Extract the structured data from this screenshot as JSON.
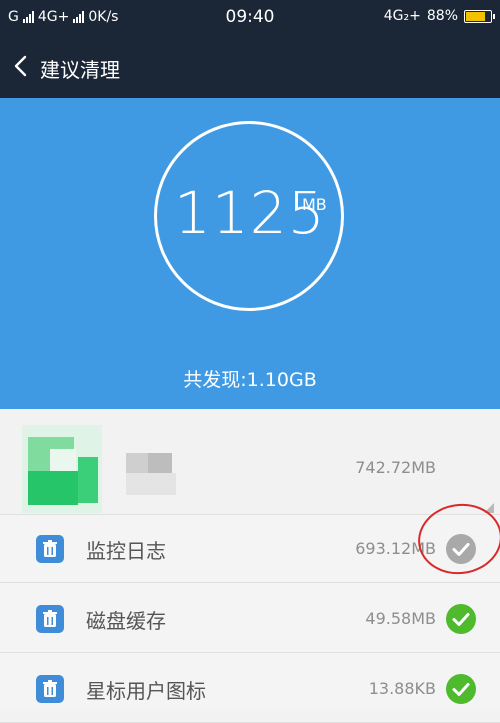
{
  "status": {
    "carrier1": "G",
    "network": "4G+",
    "speed": "0K/s",
    "time": "09:40",
    "network_right": "4G₂+",
    "battery_percent_text": "88%",
    "battery_level": 0.88
  },
  "header": {
    "title": "建议清理"
  },
  "summary": {
    "size_value": "1125",
    "size_unit": "MB",
    "found_text": "共发现:1.10GB"
  },
  "items": [
    {
      "label": "",
      "size": "742.72MB",
      "checked": null
    },
    {
      "label": "监控日志",
      "size": "693.12MB",
      "checked": false
    },
    {
      "label": "磁盘缓存",
      "size": "49.58MB",
      "checked": true
    },
    {
      "label": "星标用户图标",
      "size": "13.88KB",
      "checked": true
    }
  ],
  "colors": {
    "header_bg": "#1b2636",
    "hero_bg": "#3f9ae3",
    "check_on": "#4fba2e",
    "check_off": "#a9a9a9",
    "annotation": "#d82a2a"
  }
}
